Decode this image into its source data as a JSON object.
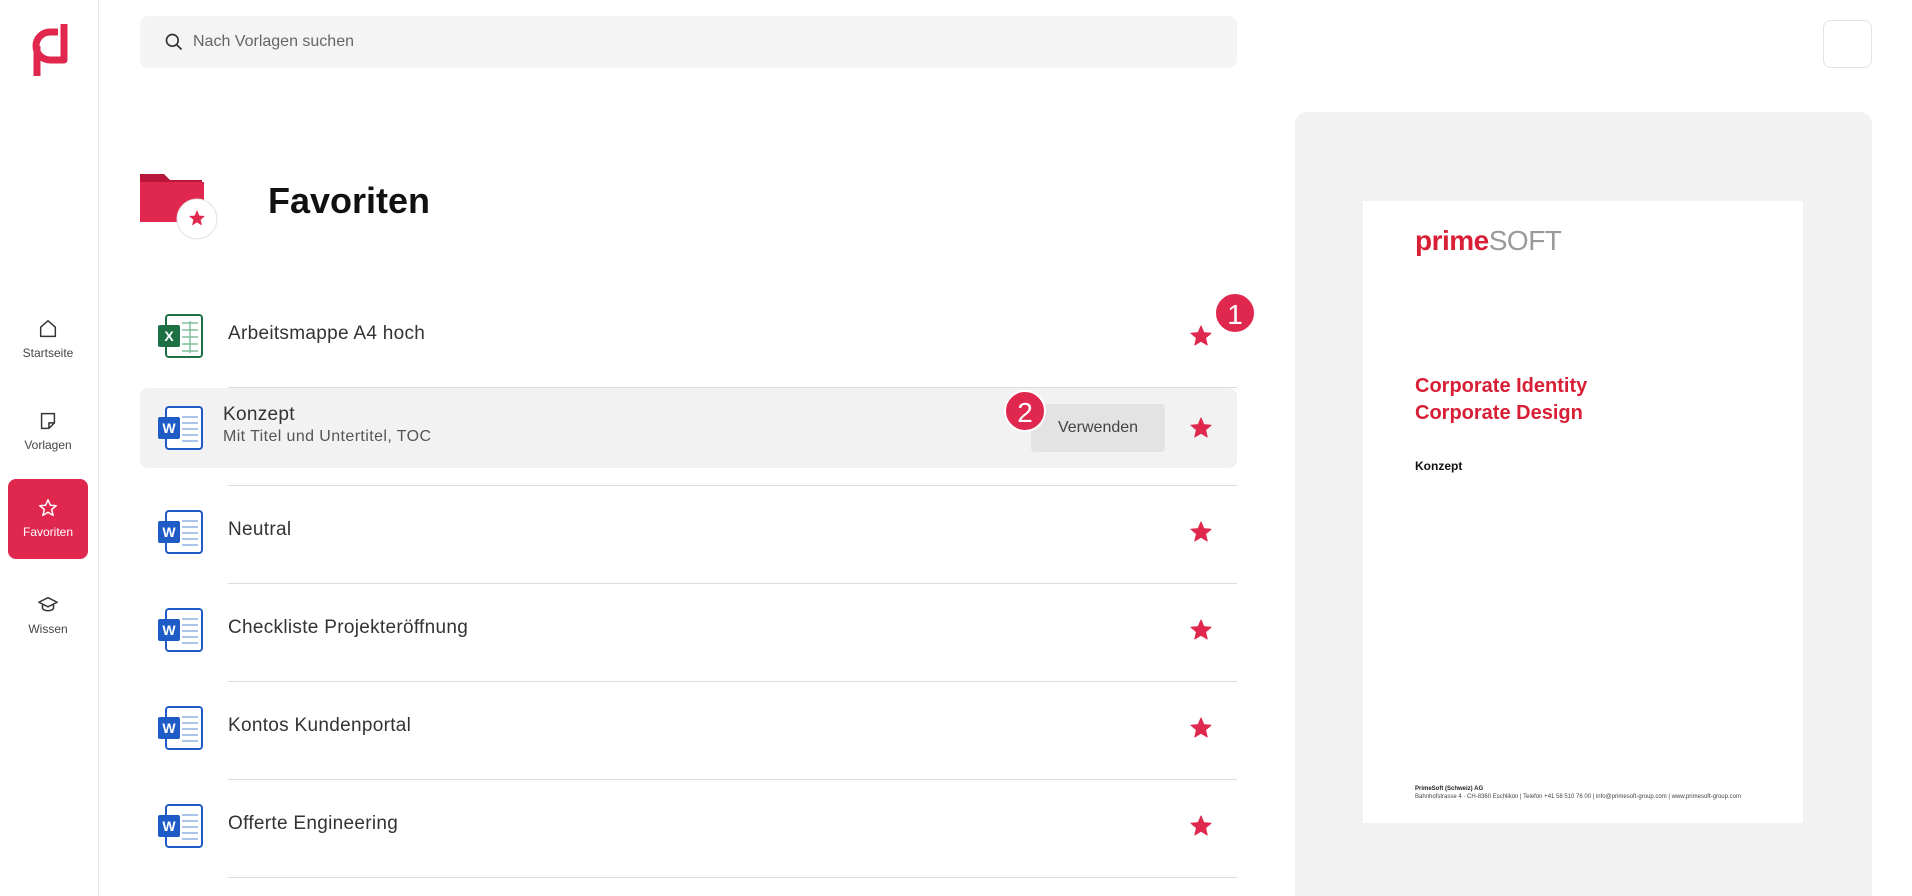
{
  "sidebar": {
    "items": [
      {
        "label": "Startseite",
        "icon": "home-icon",
        "active": false
      },
      {
        "label": "Vorlagen",
        "icon": "note-icon",
        "active": false
      },
      {
        "label": "Favoriten",
        "icon": "star-icon",
        "active": true
      },
      {
        "label": "Wissen",
        "icon": "graduation-cap-icon",
        "active": false
      }
    ]
  },
  "search": {
    "placeholder": "Nach Vorlagen suchen"
  },
  "page": {
    "title": "Favoriten"
  },
  "templates": [
    {
      "name": "Arbeitsmappe A4 hoch",
      "type": "excel"
    },
    {
      "name": "Konzept",
      "subtitle": "Mit Titel und Untertitel, TOC",
      "type": "word",
      "action": "Verwenden"
    },
    {
      "name": "Neutral",
      "type": "word"
    },
    {
      "name": "Checkliste Projekteröffnung",
      "type": "word"
    },
    {
      "name": "Kontos Kundenportal",
      "type": "word"
    },
    {
      "name": "Offerte Engineering",
      "type": "word"
    }
  ],
  "badges": [
    "1",
    "2"
  ],
  "preview": {
    "brand_primary": "prime",
    "brand_secondary": "SOFT",
    "title_line1": "Corporate Identity",
    "title_line2": "Corporate Design",
    "subtitle": "Konzept",
    "footer_company": "PrimeSoft (Schweiz) AG",
    "footer_address": "Bahnhofstrasse 4 · CH-8360 Eschlikon | Telefon +41 58 510 76 00 | info@primesoft-group.com | www.primesoft-group.com"
  },
  "colors": {
    "accent": "#e0284f",
    "excel": "#1d7044",
    "word": "#1e5bc6"
  }
}
